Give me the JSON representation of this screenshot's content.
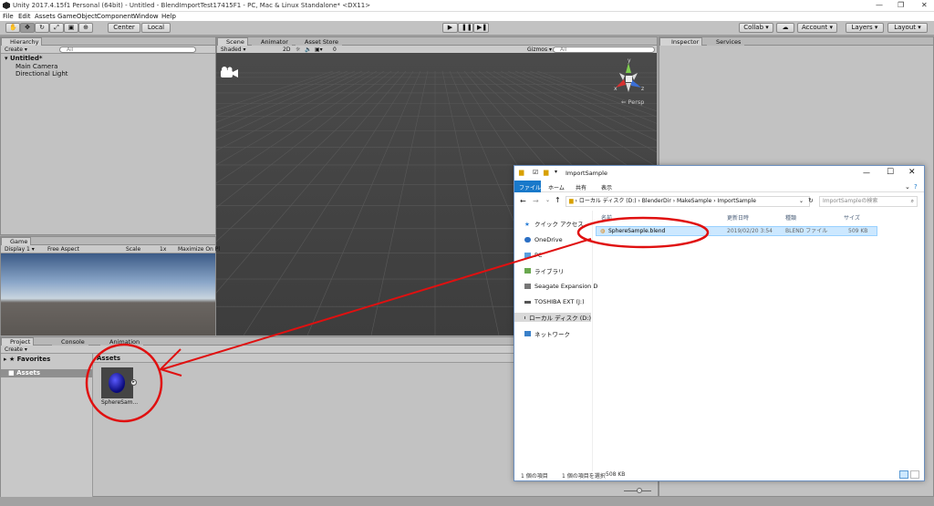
{
  "window": {
    "title": "Unity 2017.4.15f1 Personal (64bit) - Untitled - BlendImportTest17415F1 - PC, Mac & Linux Standalone* <DX11>"
  },
  "menu": [
    "File",
    "Edit",
    "Assets",
    "GameObject",
    "Component",
    "Window",
    "Help"
  ],
  "toolbar": {
    "center": "Center",
    "local": "Local",
    "collab": "Collab",
    "account": "Account",
    "layers": "Layers",
    "layout": "Layout"
  },
  "hierarchy": {
    "tab": "Hierarchy",
    "create": "Create",
    "search": "All",
    "scene": "Untitled*",
    "items": [
      "Main Camera",
      "Directional Light"
    ]
  },
  "scene": {
    "tabs": [
      "Scene",
      "Animator",
      "Asset Store"
    ],
    "shaded": "Shaded",
    "mode2d": "2D",
    "gizmos": "Gizmos",
    "search": "All",
    "persp": "Persp",
    "axes": {
      "y": "y",
      "x": "x",
      "z": "z"
    }
  },
  "game": {
    "tab": "Game",
    "display": "Display 1",
    "aspect": "Free Aspect",
    "scale_label": "Scale",
    "scale_value": "1x",
    "maximize": "Maximize On Pl"
  },
  "inspector": {
    "tabs": [
      "Inspector",
      "Services"
    ]
  },
  "project": {
    "tabs": [
      "Project",
      "Console",
      "Animation"
    ],
    "create": "Create",
    "favorites": "Favorites",
    "assets_tree": "Assets",
    "assets_header": "Assets",
    "asset_name": "SphereSam..."
  },
  "explorer": {
    "title": "ImportSample",
    "ribbon": [
      "ファイル",
      "ホーム",
      "共有",
      "表示"
    ],
    "path": [
      "ローカル ディスク (D:)",
      "BlenderDir",
      "MakeSample",
      "ImportSample"
    ],
    "search_placeholder": "ImportSampleの検索",
    "columns": [
      "名前",
      "更新日時",
      "種類",
      "サイズ"
    ],
    "nav": [
      "クイック アクセス",
      "OneDrive",
      "PC",
      "ライブラリ",
      "Seagate Expansion D",
      "TOSHIBA EXT (J:)",
      "ローカル ディスク (D:)",
      "ネットワーク"
    ],
    "file": {
      "name": "SphereSample.blend",
      "date": "2019/02/20 3:54",
      "type": "BLEND ファイル",
      "size": "509 KB"
    },
    "status": [
      "1 個の項目",
      "1 個の項目を選択",
      "508 KB"
    ]
  },
  "colors": {
    "annotation": "#e01010",
    "unity_bg": "#c2c2c2",
    "scene_bg": "#444444",
    "selected": "#cce8ff"
  }
}
